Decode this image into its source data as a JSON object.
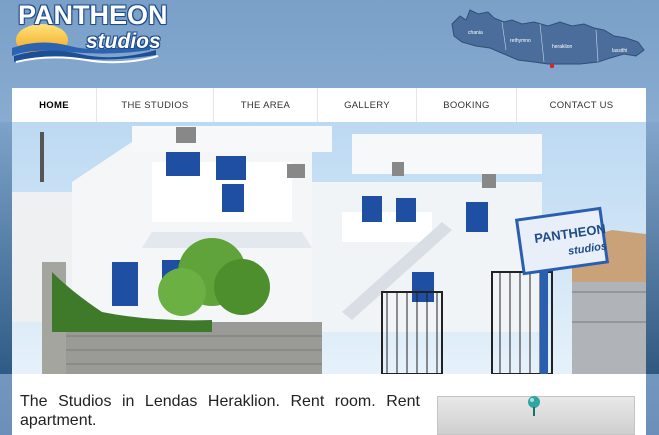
{
  "logo": {
    "line1": "PANTHEON",
    "line2": "studios"
  },
  "map": {
    "towns": [
      "chania",
      "rethymno",
      "heraklion",
      "lassithi"
    ],
    "colors": {
      "island": "#4a6d9c",
      "marker": "#e02020"
    }
  },
  "nav": {
    "items": [
      {
        "label": "HOME",
        "active": true
      },
      {
        "label": "THE STUDIOS"
      },
      {
        "label": "THE AREA"
      },
      {
        "label": "GALLERY"
      },
      {
        "label": "BOOKING"
      },
      {
        "label": "CONTACT US"
      }
    ]
  },
  "hero": {
    "sign_line1": "PANTHEON",
    "sign_line2": "studios"
  },
  "content": {
    "intro": "The Studios in Lendas Heraklion. Rent room. Rent apartment."
  },
  "colors": {
    "accent": "#1e4c8c",
    "sky": "#8fb0d3"
  }
}
